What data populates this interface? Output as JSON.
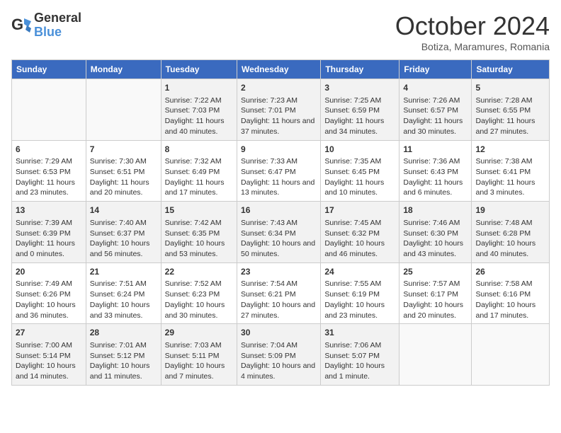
{
  "header": {
    "logo_general": "General",
    "logo_blue": "Blue",
    "title": "October 2024",
    "subtitle": "Botiza, Maramures, Romania"
  },
  "days_of_week": [
    "Sunday",
    "Monday",
    "Tuesday",
    "Wednesday",
    "Thursday",
    "Friday",
    "Saturday"
  ],
  "weeks": [
    [
      {
        "day": "",
        "info": ""
      },
      {
        "day": "",
        "info": ""
      },
      {
        "day": "1",
        "info": "Sunrise: 7:22 AM\nSunset: 7:03 PM\nDaylight: 11 hours and 40 minutes."
      },
      {
        "day": "2",
        "info": "Sunrise: 7:23 AM\nSunset: 7:01 PM\nDaylight: 11 hours and 37 minutes."
      },
      {
        "day": "3",
        "info": "Sunrise: 7:25 AM\nSunset: 6:59 PM\nDaylight: 11 hours and 34 minutes."
      },
      {
        "day": "4",
        "info": "Sunrise: 7:26 AM\nSunset: 6:57 PM\nDaylight: 11 hours and 30 minutes."
      },
      {
        "day": "5",
        "info": "Sunrise: 7:28 AM\nSunset: 6:55 PM\nDaylight: 11 hours and 27 minutes."
      }
    ],
    [
      {
        "day": "6",
        "info": "Sunrise: 7:29 AM\nSunset: 6:53 PM\nDaylight: 11 hours and 23 minutes."
      },
      {
        "day": "7",
        "info": "Sunrise: 7:30 AM\nSunset: 6:51 PM\nDaylight: 11 hours and 20 minutes."
      },
      {
        "day": "8",
        "info": "Sunrise: 7:32 AM\nSunset: 6:49 PM\nDaylight: 11 hours and 17 minutes."
      },
      {
        "day": "9",
        "info": "Sunrise: 7:33 AM\nSunset: 6:47 PM\nDaylight: 11 hours and 13 minutes."
      },
      {
        "day": "10",
        "info": "Sunrise: 7:35 AM\nSunset: 6:45 PM\nDaylight: 11 hours and 10 minutes."
      },
      {
        "day": "11",
        "info": "Sunrise: 7:36 AM\nSunset: 6:43 PM\nDaylight: 11 hours and 6 minutes."
      },
      {
        "day": "12",
        "info": "Sunrise: 7:38 AM\nSunset: 6:41 PM\nDaylight: 11 hours and 3 minutes."
      }
    ],
    [
      {
        "day": "13",
        "info": "Sunrise: 7:39 AM\nSunset: 6:39 PM\nDaylight: 11 hours and 0 minutes."
      },
      {
        "day": "14",
        "info": "Sunrise: 7:40 AM\nSunset: 6:37 PM\nDaylight: 10 hours and 56 minutes."
      },
      {
        "day": "15",
        "info": "Sunrise: 7:42 AM\nSunset: 6:35 PM\nDaylight: 10 hours and 53 minutes."
      },
      {
        "day": "16",
        "info": "Sunrise: 7:43 AM\nSunset: 6:34 PM\nDaylight: 10 hours and 50 minutes."
      },
      {
        "day": "17",
        "info": "Sunrise: 7:45 AM\nSunset: 6:32 PM\nDaylight: 10 hours and 46 minutes."
      },
      {
        "day": "18",
        "info": "Sunrise: 7:46 AM\nSunset: 6:30 PM\nDaylight: 10 hours and 43 minutes."
      },
      {
        "day": "19",
        "info": "Sunrise: 7:48 AM\nSunset: 6:28 PM\nDaylight: 10 hours and 40 minutes."
      }
    ],
    [
      {
        "day": "20",
        "info": "Sunrise: 7:49 AM\nSunset: 6:26 PM\nDaylight: 10 hours and 36 minutes."
      },
      {
        "day": "21",
        "info": "Sunrise: 7:51 AM\nSunset: 6:24 PM\nDaylight: 10 hours and 33 minutes."
      },
      {
        "day": "22",
        "info": "Sunrise: 7:52 AM\nSunset: 6:23 PM\nDaylight: 10 hours and 30 minutes."
      },
      {
        "day": "23",
        "info": "Sunrise: 7:54 AM\nSunset: 6:21 PM\nDaylight: 10 hours and 27 minutes."
      },
      {
        "day": "24",
        "info": "Sunrise: 7:55 AM\nSunset: 6:19 PM\nDaylight: 10 hours and 23 minutes."
      },
      {
        "day": "25",
        "info": "Sunrise: 7:57 AM\nSunset: 6:17 PM\nDaylight: 10 hours and 20 minutes."
      },
      {
        "day": "26",
        "info": "Sunrise: 7:58 AM\nSunset: 6:16 PM\nDaylight: 10 hours and 17 minutes."
      }
    ],
    [
      {
        "day": "27",
        "info": "Sunrise: 7:00 AM\nSunset: 5:14 PM\nDaylight: 10 hours and 14 minutes."
      },
      {
        "day": "28",
        "info": "Sunrise: 7:01 AM\nSunset: 5:12 PM\nDaylight: 10 hours and 11 minutes."
      },
      {
        "day": "29",
        "info": "Sunrise: 7:03 AM\nSunset: 5:11 PM\nDaylight: 10 hours and 7 minutes."
      },
      {
        "day": "30",
        "info": "Sunrise: 7:04 AM\nSunset: 5:09 PM\nDaylight: 10 hours and 4 minutes."
      },
      {
        "day": "31",
        "info": "Sunrise: 7:06 AM\nSunset: 5:07 PM\nDaylight: 10 hours and 1 minute."
      },
      {
        "day": "",
        "info": ""
      },
      {
        "day": "",
        "info": ""
      }
    ]
  ]
}
